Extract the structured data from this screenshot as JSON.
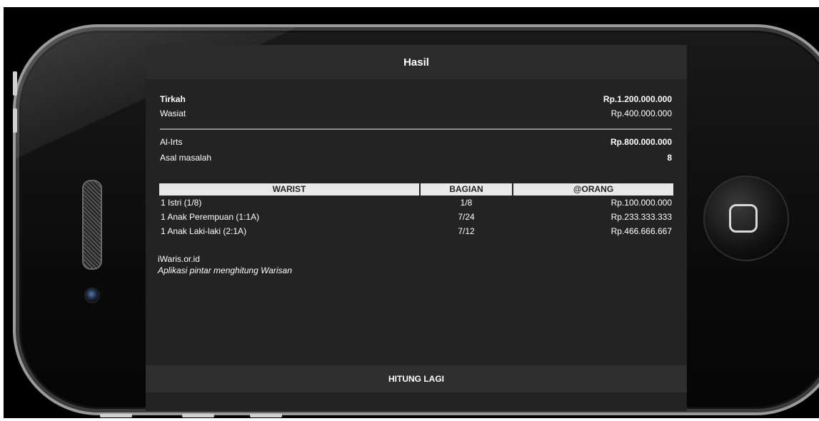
{
  "header": {
    "title": "Hasil"
  },
  "summary": {
    "tirkah_label": "Tirkah",
    "tirkah_value": "Rp.1.200.000.000",
    "wasiat_label": "Wasiat",
    "wasiat_value": "Rp.400.000.000",
    "alirts_label": "Al-Irts",
    "alirts_value": "Rp.800.000.000",
    "asal_label": "Asal masalah",
    "asal_value": "8"
  },
  "table": {
    "headers": [
      "WARIST",
      "BAGIAN",
      "@ORANG"
    ],
    "rows": [
      [
        "1 Istri (1/8)",
        "1/8",
        "Rp.100.000.000"
      ],
      [
        "1 Anak Perempuan (1:1A)",
        "7/24",
        "Rp.233.333.333"
      ],
      [
        "1 Anak Laki-laki (2:1A)",
        "7/12",
        "Rp.466.666.667"
      ]
    ]
  },
  "footer": {
    "site": "iWaris.or.id",
    "tagline": "Aplikasi pintar menghitung Warisan"
  },
  "action": {
    "button_label": "HITUNG LAGI"
  }
}
